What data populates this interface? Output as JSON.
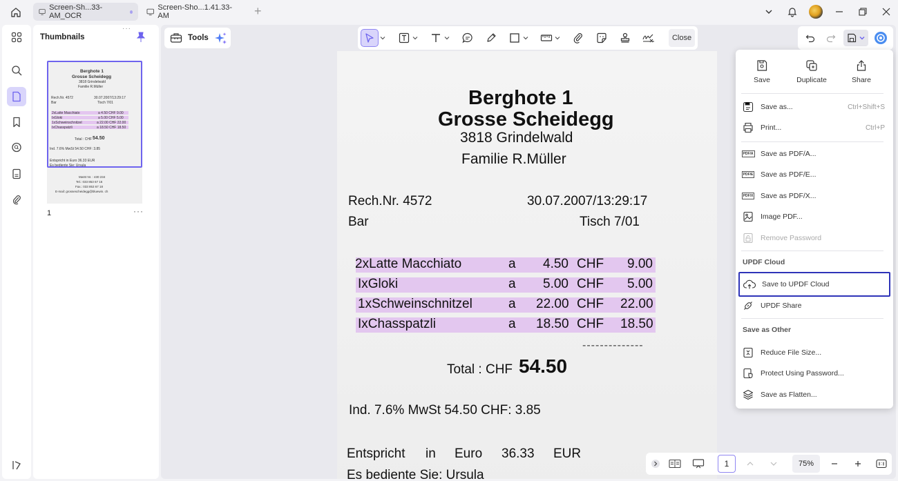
{
  "tabs": [
    {
      "label": "Screen-Sh...33-AM_OCR",
      "active": true,
      "modified": true
    },
    {
      "label": "Screen-Sho...1.41.33-AM",
      "active": false
    }
  ],
  "new_tab": "+",
  "sidebar": {
    "title": "Thumbnails",
    "page_number": "1",
    "more": "···",
    "handle": "···"
  },
  "thumbnail": {
    "lines": [
      "Berghote 1",
      "Grosse Scheidegg",
      "3818 Grindelwald",
      "Familie R.Müller",
      "Rech.Nr. 4572",
      "30.07.2007/13:29:17",
      "Bar",
      "Tisch 7/01",
      "2xLatte Macchiato",
      "a 4.50 CHF 9.00",
      "IxGloki",
      "a 5.00 CHF 5.00",
      "1xSchweinschnitzel",
      "a 22.00 CHF 22.00",
      "IxChasspatzli",
      "a 18.50 CHF 18.50",
      "Total : CHF",
      "54.50",
      "Ind. 7.6% MwSt 54.50 CHF: 3.85",
      "Entspricht in Euro 36.33 EUR",
      "Es bediente Sie: Ursula",
      "MwSt Nr. : 430 234",
      "Tel.: 033 853 67 16",
      "Fax.: 033 853 67 18",
      "E-mail: grossescheidegg@bluewin. ch"
    ]
  },
  "tools": {
    "label": "Tools"
  },
  "toolbar": {
    "close_label": "Close"
  },
  "document": {
    "title1": "Berghote 1",
    "title2": "Grosse Scheidegg",
    "city": "3818 Grindelwald",
    "family": "Familie R.Müller",
    "rech": "Rech.Nr. 4572",
    "datetime": "30.07.2007/13:29:17",
    "bar": "Bar",
    "tisch": "Tisch 7/01",
    "items": [
      {
        "name": "2xLatte Macchiato",
        "a": "a",
        "price": "4.50",
        "cur": "CHF",
        "total": "9.00"
      },
      {
        "name": "IxGloki",
        "a": "a",
        "price": "5.00",
        "cur": "CHF",
        "total": "5.00"
      },
      {
        "name": "1xSchweinschnitzel",
        "a": "a",
        "price": "22.00",
        "cur": "CHF",
        "total": "22.00"
      },
      {
        "name": "IxChasspatzli",
        "a": "a",
        "price": "18.50",
        "cur": "CHF",
        "total": "18.50"
      }
    ],
    "dashes": "--------------",
    "total_label": "Total : CHF",
    "total_value": "54.50",
    "mwst": "Ind. 7.6% MwSt 54.50 CHF: 3.85",
    "euro_1": "Entspricht",
    "euro_2": "in",
    "euro_3": "Euro",
    "euro_4": "36.33",
    "euro_5": "EUR",
    "served": "Es bediente Sie: Ursula"
  },
  "bottombar": {
    "page": "1",
    "zoom": "75%"
  },
  "save_menu": {
    "top_actions": [
      {
        "label": "Save",
        "icon": "save-icon"
      },
      {
        "label": "Duplicate",
        "icon": "duplicate-icon"
      },
      {
        "label": "Share",
        "icon": "share-icon"
      }
    ],
    "items": [
      {
        "label": "Save as...",
        "shortcut": "Ctrl+Shift+S",
        "icon": "save-as-icon"
      },
      {
        "label": "Print...",
        "shortcut": "Ctrl+P",
        "icon": "print-icon"
      },
      {
        "label": "Save as PDF/A...",
        "icon": "pdf-a-icon",
        "tag": "PDF/A"
      },
      {
        "label": "Save as PDF/E...",
        "icon": "pdf-e-icon",
        "tag": "PDF/E"
      },
      {
        "label": "Save as PDF/X...",
        "icon": "pdf-x-icon",
        "tag": "PDF/X"
      },
      {
        "label": "Image PDF...",
        "icon": "image-pdf-icon"
      },
      {
        "label": "Remove Password",
        "icon": "remove-password-icon",
        "disabled": true
      }
    ],
    "cloud_section": "UPDF Cloud",
    "cloud_items": [
      {
        "label": "Save to UPDF Cloud",
        "icon": "cloud-upload-icon",
        "focused": true
      },
      {
        "label": "UPDF Share",
        "icon": "link-icon"
      }
    ],
    "other_section": "Save as Other",
    "other_items": [
      {
        "label": "Reduce File Size...",
        "icon": "reduce-size-icon"
      },
      {
        "label": "Protect Using Password...",
        "icon": "protect-icon"
      },
      {
        "label": "Save as Flatten...",
        "icon": "flatten-icon"
      }
    ]
  },
  "colors": {
    "accent": "#6d63ee",
    "accent_light": "#d9d5fb",
    "highlight": "#e3c7ef",
    "focus_border": "#2e33b8"
  }
}
